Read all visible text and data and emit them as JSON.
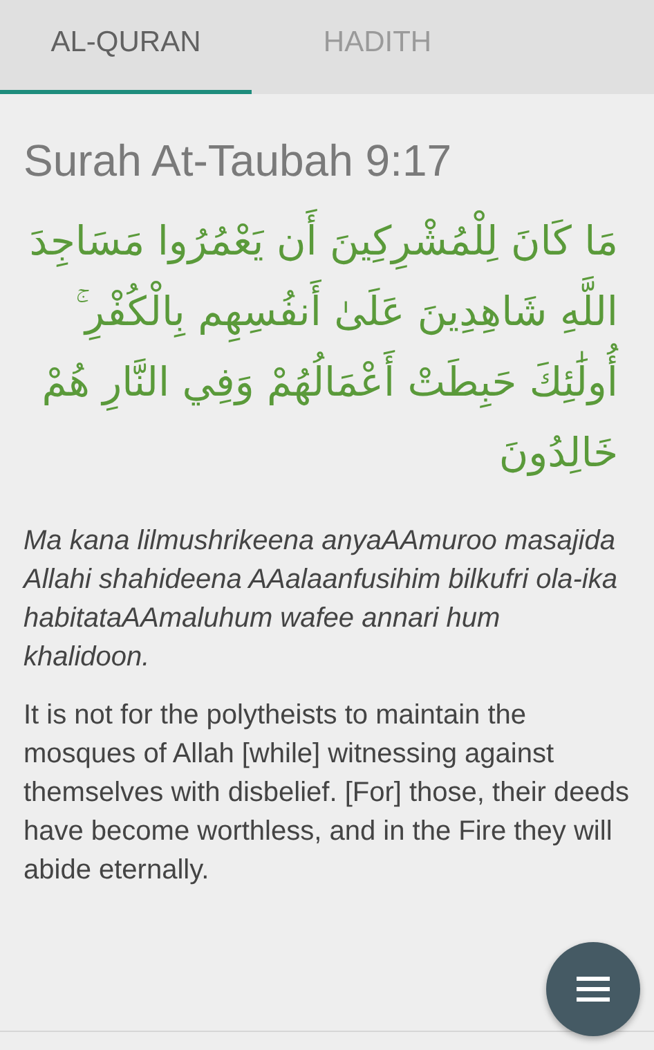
{
  "tabs": [
    {
      "label": "AL-QURAN",
      "selected": true
    },
    {
      "label": "HADITH",
      "selected": false
    }
  ],
  "verse": {
    "title": "Surah At-Taubah 9:17",
    "arabic": "مَا كَانَ لِلْمُشْرِكِينَ أَن يَعْمُرُوا مَسَاجِدَ اللَّهِ شَاهِدِينَ عَلَىٰ أَنفُسِهِم بِالْكُفْرِ ۚ أُولَٰئِكَ حَبِطَتْ أَعْمَالُهُمْ وَفِي النَّارِ هُمْ خَالِدُونَ",
    "transliteration": "Ma kana lilmushrikeena anyaAAmuroo masajida Allahi shahideena AAalaanfusihim bilkufri ola-ika habitataAAmaluhum wafee annari hum khalidoon.",
    "translation": "It is not for the polytheists to maintain the mosques of Allah [while] witnessing against themselves with disbelief. [For] those, their deeds have become worthless, and in the Fire they will abide eternally."
  }
}
